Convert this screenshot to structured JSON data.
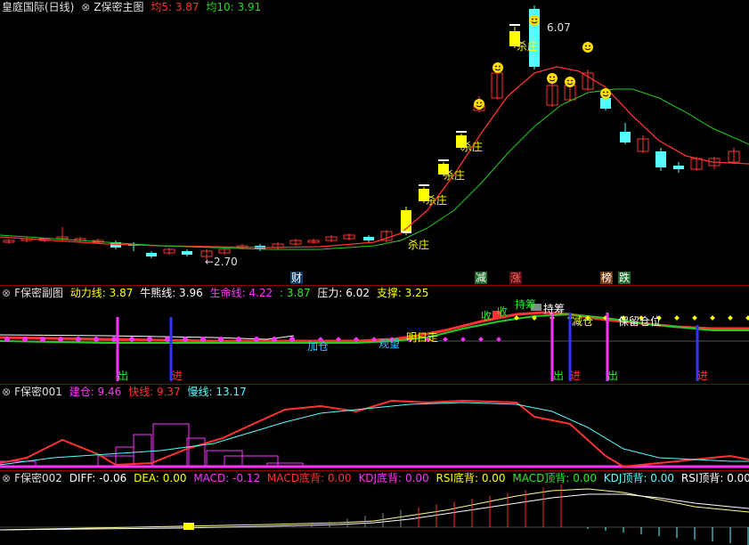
{
  "main": {
    "title": "皇庭国际(日线)",
    "indicator": "Z保密主图",
    "ma5": "均5: 3.87",
    "ma10": "均10: 3.91",
    "high_label": "6.07",
    "low_label": "←2.70",
    "sell_label": "杀庄",
    "markers": [
      "财",
      "减",
      "涨",
      "榜",
      "跌"
    ]
  },
  "sub1": {
    "name": "F保密副图",
    "power": "动力线: 3.87",
    "bull": "牛熊线: 3.96",
    "life": "生命线: 4.22",
    "extra": ": 3.87",
    "pressure": "压力: 6.02",
    "support": "支撑: 3.25",
    "exit_label": "出",
    "enter_label": "进",
    "ann_add": "加仓",
    "ann_watch": "观望",
    "ann_rise": "明日走",
    "ann_collect": "收",
    "ann_hold": "持筹",
    "ann_hold2": "持筹",
    "ann_reduce": "减仓",
    "ann_keep": "保留仓位"
  },
  "sub2": {
    "name": "F保密001",
    "build": "建仓: 9.46",
    "fast": "快线: 9.37",
    "slow": "慢线: 13.17"
  },
  "sub3": {
    "name": "F保密002",
    "diff": "DIFF: -0.06",
    "dea": "DEA: 0.00",
    "macd": "MACD: -0.12",
    "macd_bottom": "MACD底背: 0.00",
    "kdj_bottom": "KDJ底背: 0.00",
    "rsi_bottom": "RSI底背: 0.00",
    "macd_top": "MACD顶背: 0.00",
    "kdj_top": "KDJ顶背: 0.00",
    "rsi_top": "RSI顶背: 0.00"
  },
  "colors": {
    "up": "#ff3232",
    "down": "#54ffff",
    "ma5": "#ff3232",
    "ma10": "#22cc22",
    "yellow": "#ffff00",
    "magenta": "#ff33ff",
    "blue": "#3333ff"
  }
}
